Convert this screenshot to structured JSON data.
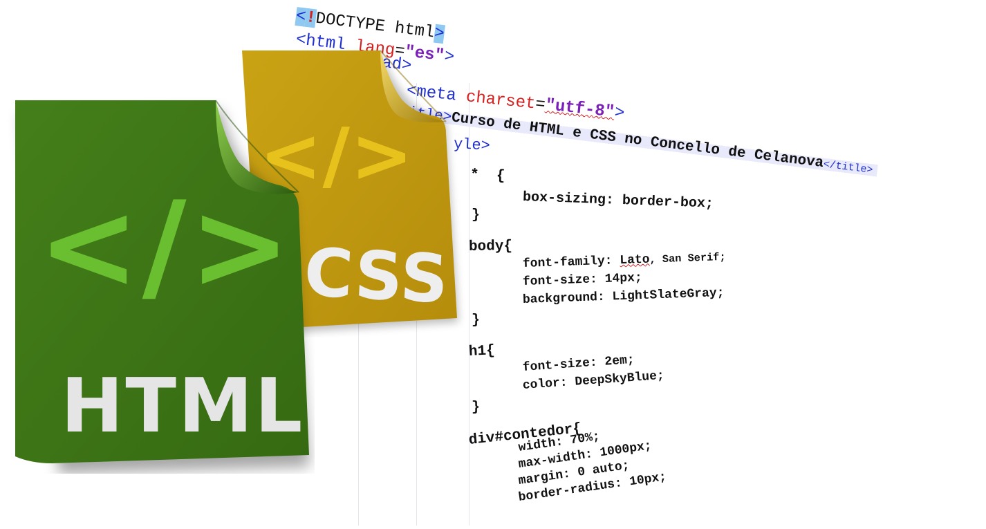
{
  "code": {
    "doctype": {
      "open": "<",
      "bang": "!",
      "text": "DOCTYPE html",
      "close": ">"
    },
    "html_line": {
      "tag_open": "<html",
      "attr": " lang",
      "eq": "=",
      "value": "\"es\"",
      "close": ">"
    },
    "head_line": "ead>",
    "meta_line": {
      "tag_open": "<meta",
      "attr": " charset",
      "eq": "=",
      "value": "\"utf-8\"",
      "close": ">"
    },
    "title_line": {
      "tag_open": "title>",
      "text": "Curso de HTML e CSS no Concello de Celanova",
      "tag_close": "</title>"
    },
    "style_line": "yle>",
    "css_lines": [
      "*  {",
      "box-sizing: border-box;",
      "}",
      "body{",
      "font-family: Lato, San Serif;",
      "font-size: 14px;",
      "background: LightSlateGray;",
      "}",
      "h1{",
      "font-size: 2em;",
      "color: DeepSkyBlue;",
      "}",
      "div#contedor{",
      "width: 70%;",
      "max-width: 1000px;",
      "margin: 0 auto;",
      "border-radius: 10px;"
    ]
  },
  "icons": {
    "html": {
      "label": "HTML",
      "glyph": "</>",
      "color": "#3f7b17",
      "accent": "#6cc133"
    },
    "css": {
      "label": "CSS",
      "glyph": "</>",
      "color": "#c49c12",
      "accent": "#e4c41e"
    }
  },
  "colors": {
    "tag": "#1f2fcf",
    "attribute": "#d62020",
    "string": "#7a1fb8",
    "highlight": "#8fc8f0"
  }
}
